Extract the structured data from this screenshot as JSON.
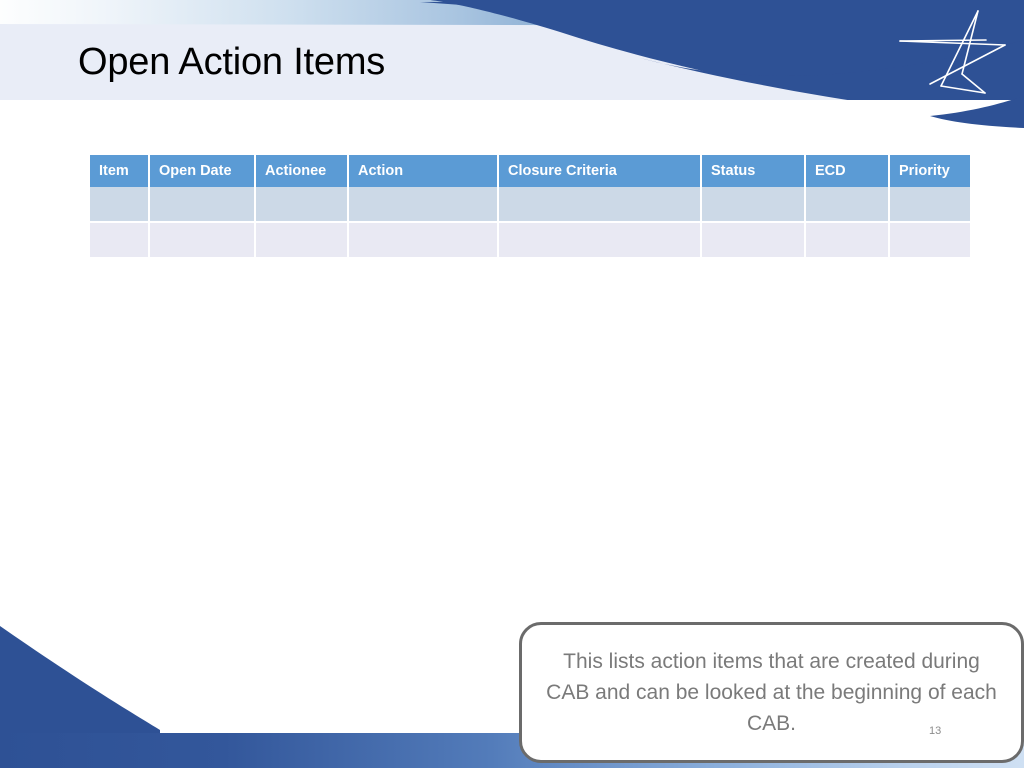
{
  "slide": {
    "title": "Open Action Items",
    "page_number": "13",
    "colors": {
      "header_band": "#e9edf7",
      "brand_dark_blue": "#2e5195",
      "table_header_blue": "#5b9bd5",
      "row_band_a": "#ccd9e7",
      "row_band_b": "#e9e9f3",
      "callout_border": "#6b6b6b",
      "callout_text": "#7a7a7a",
      "title_text": "#000000"
    },
    "logo": {
      "name": "lockheed-martin-star-logo",
      "color": "#ffffff"
    }
  },
  "table": {
    "name": "open-action-items-table",
    "columns": [
      {
        "key": "item",
        "label": "Item"
      },
      {
        "key": "opendate",
        "label": "Open Date"
      },
      {
        "key": "actionee",
        "label": "Actionee"
      },
      {
        "key": "action",
        "label": "Action"
      },
      {
        "key": "closure",
        "label": "Closure Criteria"
      },
      {
        "key": "status",
        "label": "Status"
      },
      {
        "key": "ecd",
        "label": "ECD"
      },
      {
        "key": "priority",
        "label": "Priority"
      }
    ],
    "rows": [
      {
        "item": "",
        "opendate": "",
        "actionee": "",
        "action": "",
        "closure": "",
        "status": "",
        "ecd": "",
        "priority": ""
      },
      {
        "item": "",
        "opendate": "",
        "actionee": "",
        "action": "",
        "closure": "",
        "status": "",
        "ecd": "",
        "priority": ""
      }
    ]
  },
  "callout": {
    "name": "explanatory-callout",
    "text": "This lists action items that are created during CAB and can be looked at the beginning of each CAB."
  }
}
